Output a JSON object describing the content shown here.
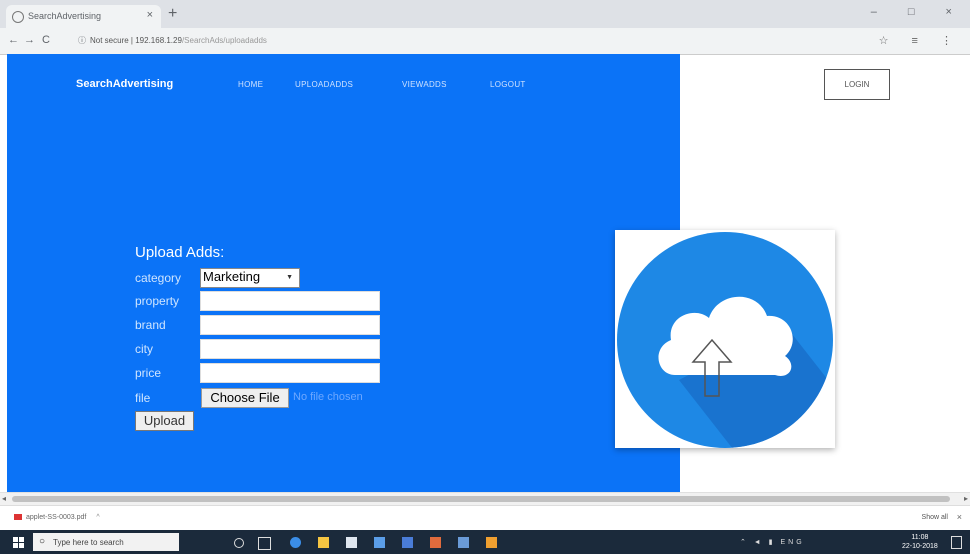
{
  "browser": {
    "tab_title": "SearchAdvertising",
    "tab_close": "×",
    "new_tab": "+",
    "window_controls": "–  □  ×",
    "back": "←",
    "forward": "→",
    "reload": "C",
    "lock_label": "Not secure",
    "url_host": "192.168.1.29",
    "url_path": "/SearchAds/uploadadds",
    "toolbar_icons": "☆ ≡ ⋮"
  },
  "site": {
    "brand": "SearchAdvertising",
    "nav": [
      "HOME",
      "UPLOADADDS",
      "VIEWADDS",
      "LOGOUT"
    ],
    "login_label": "LOGIN"
  },
  "form": {
    "title": "Upload Adds:",
    "labels": {
      "category": "category",
      "property": "property",
      "brand": "brand",
      "city": "city",
      "price": "price",
      "file": "file"
    },
    "category_value": "Marketing",
    "choose_file_label": "Choose File",
    "no_file_text": "No file chosen",
    "upload_label": "Upload"
  },
  "image": {
    "description_icon": "cloud-upload-icon",
    "circle_color": "#1e88e5",
    "cloud_color": "#ffffff"
  },
  "scrollbar": {
    "left_arrow": "◂",
    "right_arrow": "▸"
  },
  "downloads": {
    "file_name": "applet-SS-0003.pdf",
    "chevron": "^",
    "show_all": "Show all",
    "close": "×"
  },
  "taskbar": {
    "search_placeholder": "Type here to search",
    "tray_text": "ENG",
    "time": "11:08",
    "date": "22-10-2018"
  }
}
